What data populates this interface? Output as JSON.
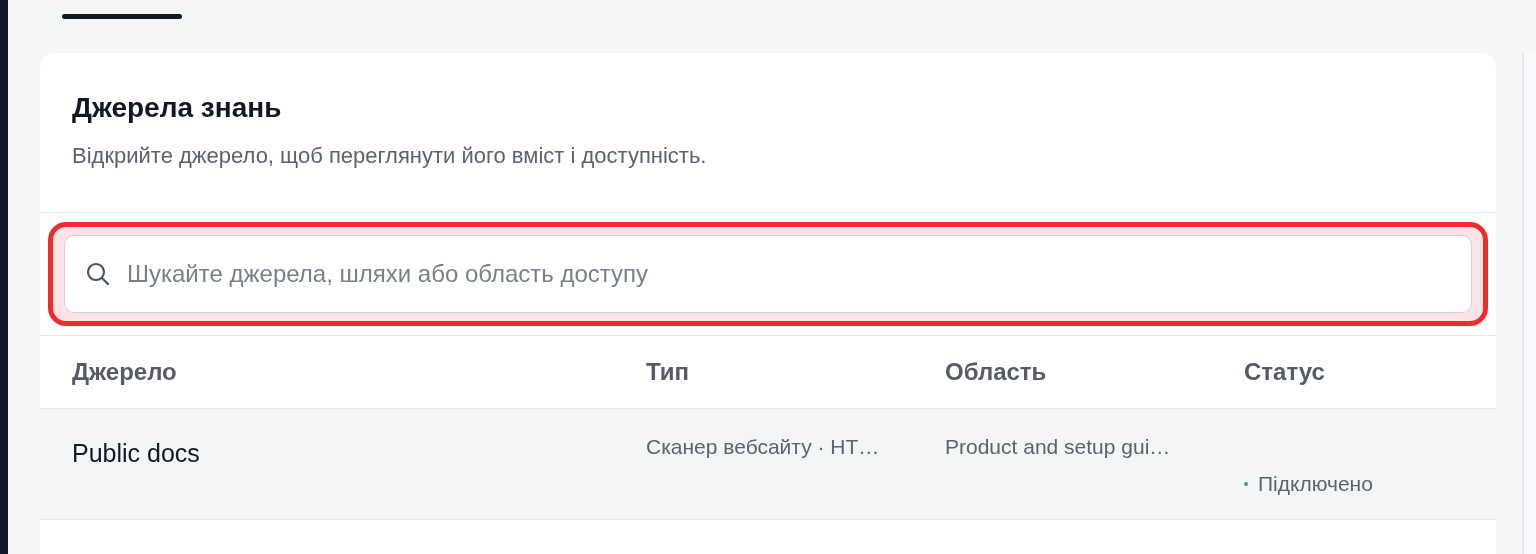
{
  "tabs": [
    {
      "selected": true
    }
  ],
  "panel": {
    "title": "Джерела знань",
    "subtitle": "Відкрийте джерело, щоб переглянути його вміст і доступність."
  },
  "search": {
    "placeholder": "Шукайте джерела, шляхи або область доступу",
    "highlighted": true
  },
  "table": {
    "columns": [
      "Джерело",
      "Тип",
      "Область",
      "Статус"
    ],
    "rows": [
      {
        "name": "Public docs",
        "type": "Сканер вебсайту · HT…",
        "scope": "Product and setup gui…",
        "status": "Підключено",
        "color": "#3f9e6a"
      }
    ]
  }
}
